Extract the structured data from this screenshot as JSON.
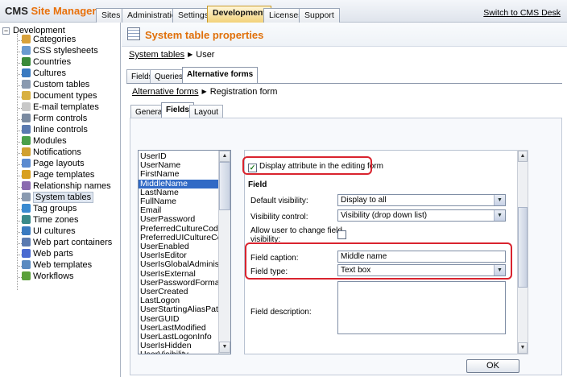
{
  "app": {
    "brand_bold": "CMS",
    "brand_accent": "Site Manager",
    "switch_link": "Switch to CMS Desk"
  },
  "top_tabs": [
    "Sites",
    "Administration",
    "Settings",
    "Development",
    "Licenses",
    "Support"
  ],
  "active_top_tab": "Development",
  "tree": {
    "root": "Development",
    "items": [
      {
        "label": "Categories",
        "icon": "categories-icon",
        "color": "#d8a13a"
      },
      {
        "label": "CSS stylesheets",
        "icon": "css-icon",
        "color": "#6a9ad0"
      },
      {
        "label": "Countries",
        "icon": "globe-icon",
        "color": "#3a8a3a"
      },
      {
        "label": "Cultures",
        "icon": "globe-icon",
        "color": "#3a7ac0"
      },
      {
        "label": "Custom tables",
        "icon": "table-icon",
        "color": "#8a9ab0"
      },
      {
        "label": "Document types",
        "icon": "document-icon",
        "color": "#d8b040"
      },
      {
        "label": "E-mail templates",
        "icon": "email-icon",
        "color": "#c8c8c8"
      },
      {
        "label": "Form controls",
        "icon": "form-control-icon",
        "color": "#7a8aa0"
      },
      {
        "label": "Inline controls",
        "icon": "inline-control-icon",
        "color": "#5a7ab0"
      },
      {
        "label": "Modules",
        "icon": "modules-icon",
        "color": "#4aa04a"
      },
      {
        "label": "Notifications",
        "icon": "notifications-icon",
        "color": "#d0a030"
      },
      {
        "label": "Page layouts",
        "icon": "layout-icon",
        "color": "#5a8ad0"
      },
      {
        "label": "Page templates",
        "icon": "template-icon",
        "color": "#d8a020"
      },
      {
        "label": "Relationship names",
        "icon": "relationship-icon",
        "color": "#8a6ab0"
      },
      {
        "label": "System tables",
        "icon": "table-icon",
        "color": "#8a9ab0"
      },
      {
        "label": "Tag groups",
        "icon": "tag-icon",
        "color": "#3a8ad0"
      },
      {
        "label": "Time zones",
        "icon": "clock-icon",
        "color": "#3a8a8a"
      },
      {
        "label": "UI cultures",
        "icon": "globe-icon",
        "color": "#3a7ac0"
      },
      {
        "label": "Web part containers",
        "icon": "container-icon",
        "color": "#5a7ab0"
      },
      {
        "label": "Web parts",
        "icon": "webpart-icon",
        "color": "#4a6ad0"
      },
      {
        "label": "Web templates",
        "icon": "web-template-icon",
        "color": "#5a8ac0"
      },
      {
        "label": "Workflows",
        "icon": "workflow-icon",
        "color": "#5aa03a"
      }
    ],
    "selected": "System tables"
  },
  "header": {
    "title": "System table properties"
  },
  "breadcrumb1": {
    "link": "System tables",
    "current": "User"
  },
  "tabs1": [
    "Fields",
    "Queries",
    "Alternative forms"
  ],
  "tabs1_active": "Alternative forms",
  "breadcrumb2": {
    "link": "Alternative forms",
    "current": "Registration form"
  },
  "tabs2": [
    "General",
    "Fields",
    "Layout"
  ],
  "tabs2_active": "Fields",
  "attributes": [
    "UserID",
    "UserName",
    "FirstName",
    "MiddleName",
    "LastName",
    "FullName",
    "Email",
    "UserPassword",
    "PreferredCultureCode",
    "PreferredUICultureCode",
    "UserEnabled",
    "UserIsEditor",
    "UserIsGlobalAdministrator",
    "UserIsExternal",
    "UserPasswordFormat",
    "UserCreated",
    "LastLogon",
    "UserStartingAliasPath",
    "UserGUID",
    "UserLastModified",
    "UserLastLogonInfo",
    "UserIsHidden",
    "UserVisibility"
  ],
  "selected_attribute": "MiddleName",
  "field": {
    "display_checkbox_label": "Display attribute in the editing form",
    "display_checked": true,
    "section_label": "Field",
    "default_visibility_label": "Default visibility:",
    "default_visibility_value": "Display to all",
    "visibility_control_label": "Visibility control:",
    "visibility_control_value": "Visibility (drop down list)",
    "allow_change_label_1": "Allow user to change field",
    "allow_change_label_2": "visibility:",
    "allow_change_checked": false,
    "caption_label": "Field caption:",
    "caption_value": "Middle name",
    "type_label": "Field type:",
    "type_value": "Text box",
    "description_label": "Field description:",
    "description_value": ""
  },
  "ok_label": "OK"
}
